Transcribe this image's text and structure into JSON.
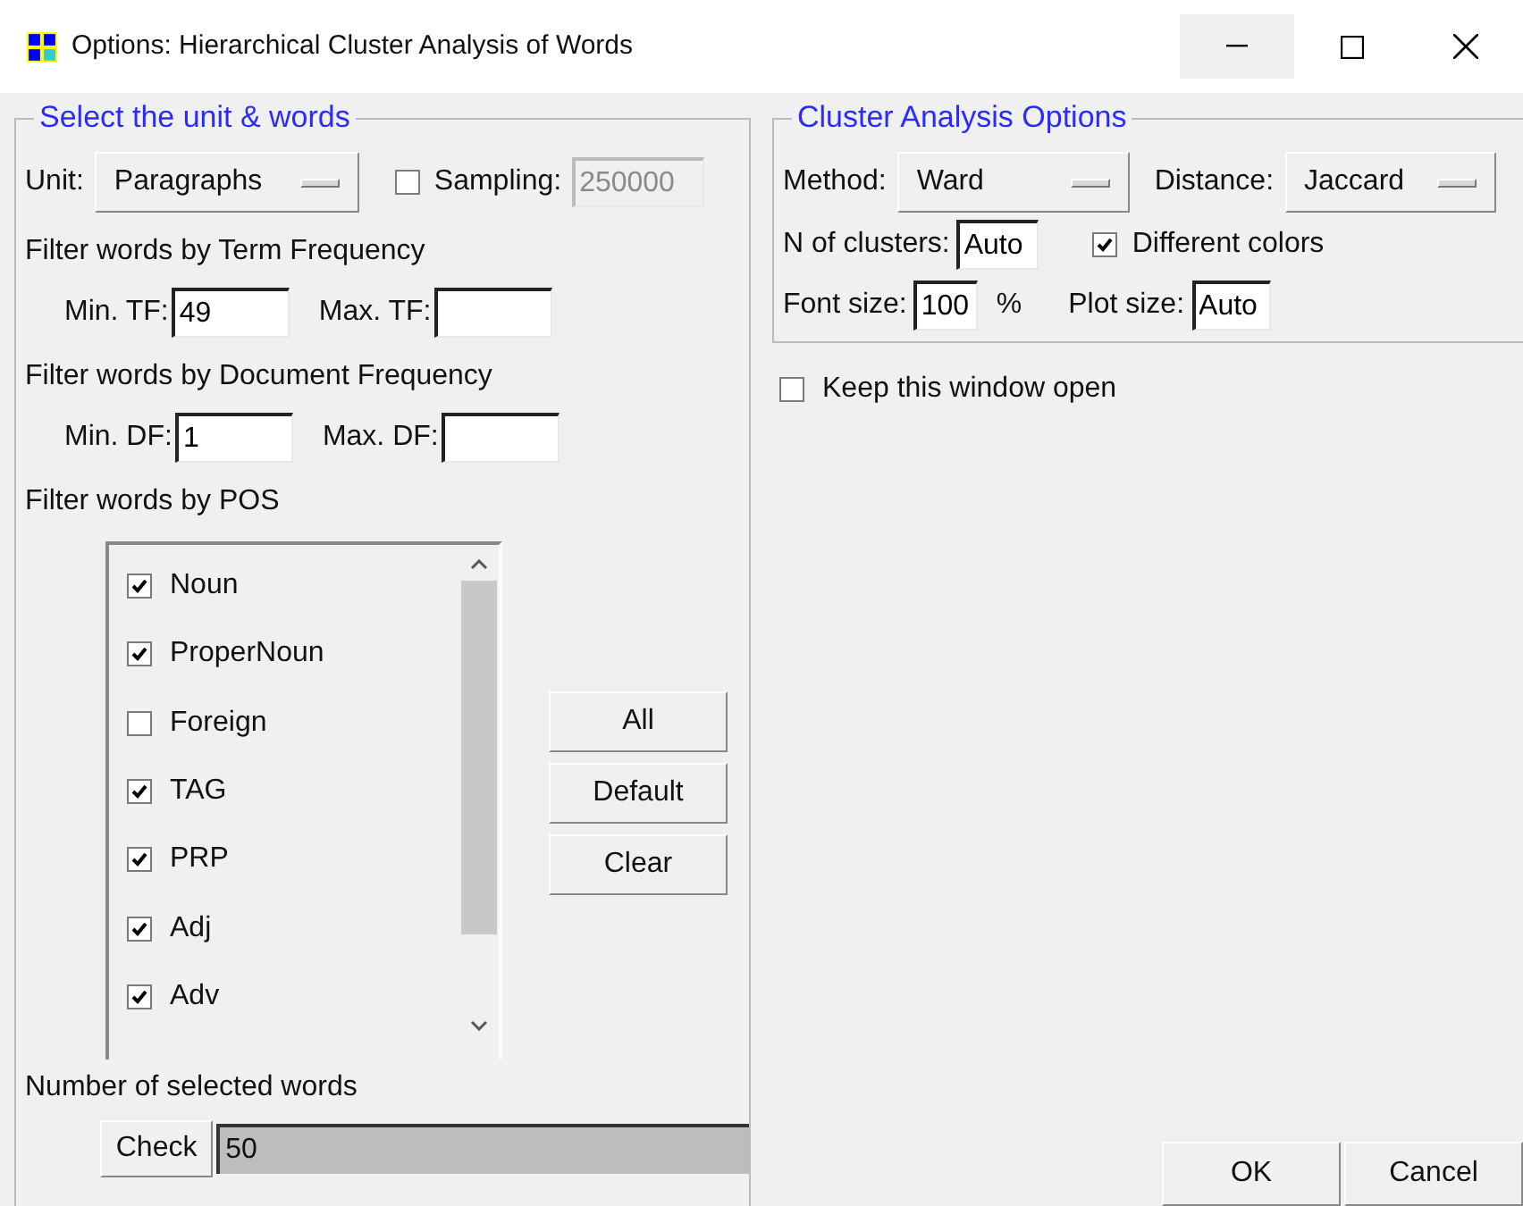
{
  "window": {
    "title": "Options: Hierarchical Cluster Analysis of Words"
  },
  "unit_section": {
    "legend": "Select the unit & words",
    "unit_label": "Unit:",
    "unit_value": "Paragraphs",
    "sampling": {
      "label": "Sampling:",
      "checked": false,
      "value": "250000",
      "disabled": true
    },
    "tf_heading": "Filter words by Term Frequency",
    "min_tf": {
      "label": "Min. TF:",
      "value": "49"
    },
    "max_tf": {
      "label": "Max. TF:"
    },
    "df_heading": "Filter words by Document Frequency",
    "min_df": {
      "label": "Min. DF:",
      "value": "1"
    },
    "max_df": {
      "label": "Max. DF:"
    },
    "pos_heading": "Filter words by POS",
    "pos_items": [
      {
        "label": "Noun",
        "checked": true
      },
      {
        "label": "ProperNoun",
        "checked": true
      },
      {
        "label": "Foreign",
        "checked": false
      },
      {
        "label": "TAG",
        "checked": true
      },
      {
        "label": "PRP",
        "checked": true
      },
      {
        "label": "Adj",
        "checked": true
      },
      {
        "label": "Adv",
        "checked": true
      }
    ],
    "pos_buttons": [
      "All",
      "Default",
      "Clear"
    ],
    "count_heading": "Number of selected words",
    "check_button": "Check",
    "count_value": "50"
  },
  "cluster_section": {
    "legend": "Cluster Analysis Options",
    "method_label": "Method:",
    "method_value": "Ward",
    "distance_label": "Distance:",
    "distance_value": "Jaccard",
    "n_clusters": {
      "label": "N of clusters:",
      "value": "Auto"
    },
    "different_colors": {
      "label": "Different colors",
      "checked": true
    },
    "font_size": {
      "label": "Font size:",
      "value": "100",
      "unit": "%"
    },
    "plot_size": {
      "label": "Plot size:",
      "value": "Auto"
    }
  },
  "keep_open": {
    "label": "Keep this window open",
    "checked": false
  },
  "buttons": [
    "OK",
    "Cancel"
  ]
}
